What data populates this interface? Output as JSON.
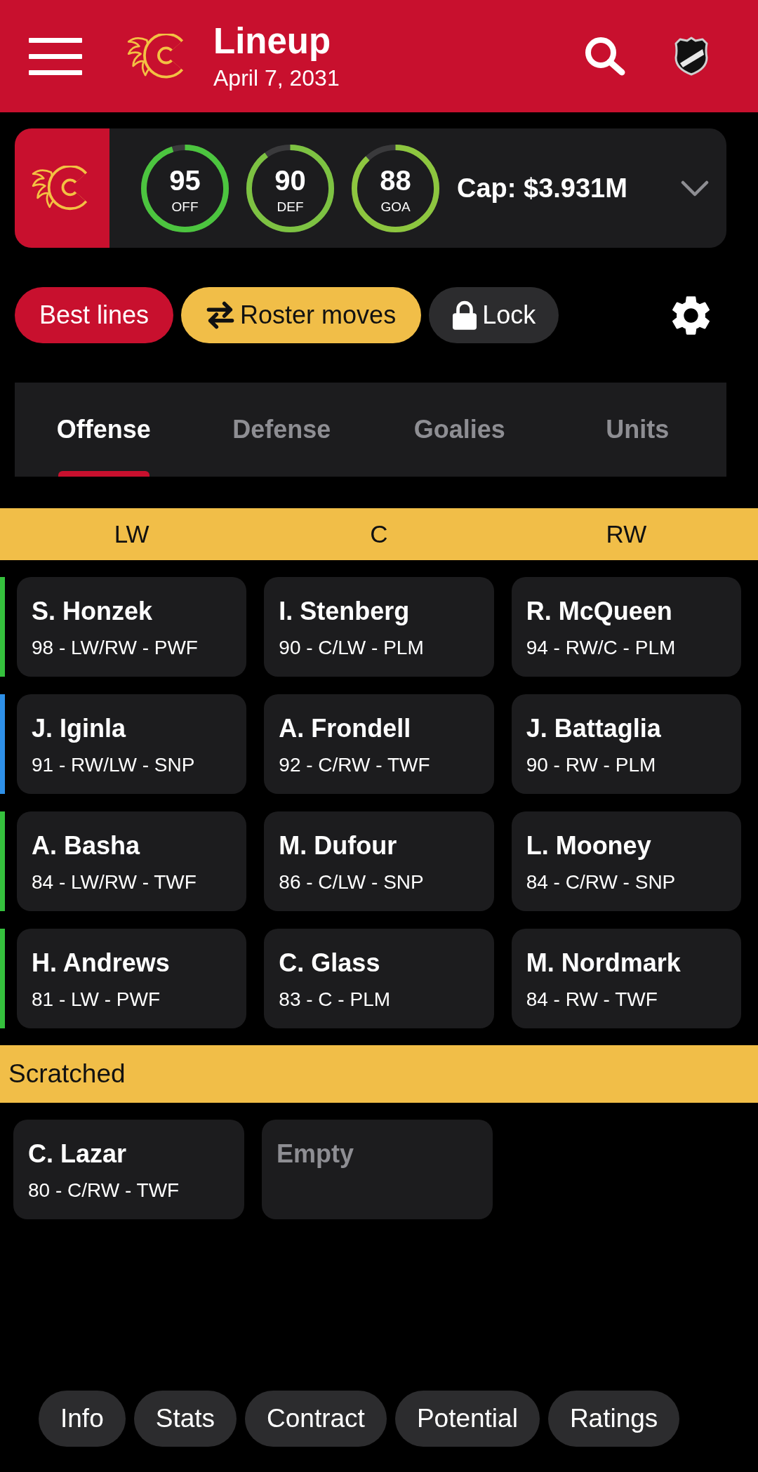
{
  "app_bar": {
    "title": "Lineup",
    "date": "April 7, 2031"
  },
  "team_summary": {
    "ratings": [
      {
        "value": "95",
        "label": "OFF",
        "level": 0.95,
        "color": "#4cc53f"
      },
      {
        "value": "90",
        "label": "DEF",
        "level": 0.9,
        "color": "#7dc242"
      },
      {
        "value": "88",
        "label": "GOA",
        "level": 0.88,
        "color": "#8dc63f"
      }
    ],
    "cap": "Cap: $3.931M"
  },
  "actions": [
    {
      "kind": "primary",
      "label": "Best lines"
    },
    {
      "kind": "swap",
      "label": "Roster moves"
    },
    {
      "kind": "lock",
      "label": "Lock"
    }
  ],
  "tabs": [
    {
      "label": "Offense",
      "selected": true
    },
    {
      "label": "Defense",
      "selected": false
    },
    {
      "label": "Goalies",
      "selected": false
    },
    {
      "label": "Units",
      "selected": false
    }
  ],
  "positions": [
    "LW",
    "C",
    "RW"
  ],
  "lines": [
    {
      "color": "#35c13d",
      "players": [
        {
          "name": "S. Honzek",
          "details": "98 - LW/RW - PWF"
        },
        {
          "name": "I. Stenberg",
          "details": "90 - C/LW - PLM"
        },
        {
          "name": "R. McQueen",
          "details": "94 - RW/C - PLM"
        }
      ]
    },
    {
      "color": "#2e90e8",
      "players": [
        {
          "name": "J. Iginla",
          "details": "91 - RW/LW - SNP"
        },
        {
          "name": "A. Frondell",
          "details": "92 - C/RW - TWF"
        },
        {
          "name": "J. Battaglia",
          "details": "90 - RW - PLM"
        }
      ]
    },
    {
      "color": "#35c13d",
      "players": [
        {
          "name": "A. Basha",
          "details": "84 - LW/RW - TWF"
        },
        {
          "name": "M. Dufour",
          "details": "86 - C/LW - SNP"
        },
        {
          "name": "L. Mooney",
          "details": "84 - C/RW - SNP"
        }
      ]
    },
    {
      "color": "#35c13d",
      "players": [
        {
          "name": "H. Andrews",
          "details": "81 - LW - PWF"
        },
        {
          "name": "C. Glass",
          "details": "83 - C - PLM"
        },
        {
          "name": "M. Nordmark",
          "details": "84 - RW - TWF"
        }
      ]
    }
  ],
  "scratched": {
    "title": "Scratched",
    "slots": [
      {
        "kind": "player",
        "name": "C. Lazar",
        "details": "80 - C/RW - TWF"
      },
      {
        "kind": "empty",
        "label": "Empty"
      }
    ]
  },
  "bottom_bar": [
    "Info",
    "Stats",
    "Contract",
    "Potential",
    "Ratings"
  ]
}
